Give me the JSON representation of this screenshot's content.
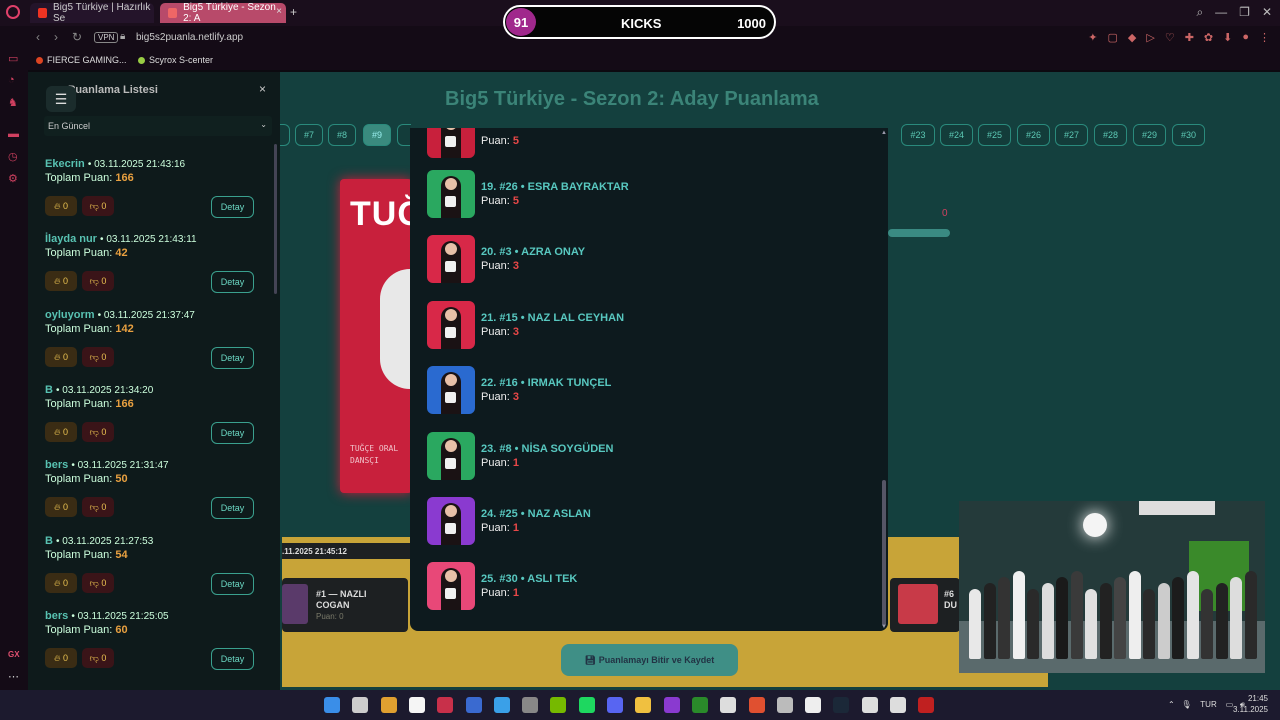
{
  "browser": {
    "tabs": [
      {
        "label": "Big5 Türkiye | Hazırlık Se"
      },
      {
        "label": "Big5 Türkiye - Sezon 2: A"
      }
    ],
    "url": "big5s2puanla.netlify.app",
    "vpn": "VPN",
    "bookmarks": [
      {
        "label": "FIERCE GAMING..."
      },
      {
        "label": "Scyrox S-center"
      }
    ],
    "gx_label": "GX"
  },
  "kicks_overlay": {
    "count": "91",
    "label": "KICKS",
    "value": "1000"
  },
  "left_panel": {
    "title": "Puanlama Listesi",
    "sort_selected": "En Güncel",
    "entries": [
      {
        "name": "Ekecrin",
        "time": "03.11.2025 21:43:16",
        "total_label": "Toplam Puan:",
        "total": "166",
        "likes": "0",
        "dislikes": "0",
        "detail": "Detay"
      },
      {
        "name": "İlayda nur",
        "time": "03.11.2025 21:43:11",
        "total_label": "Toplam Puan:",
        "total": "42",
        "likes": "0",
        "dislikes": "0",
        "detail": "Detay"
      },
      {
        "name": "oyluyorm",
        "time": "03.11.2025 21:37:47",
        "total_label": "Toplam Puan:",
        "total": "142",
        "likes": "0",
        "dislikes": "0",
        "detail": "Detay"
      },
      {
        "name": "B",
        "time": "03.11.2025 21:34:20",
        "total_label": "Toplam Puan:",
        "total": "166",
        "likes": "0",
        "dislikes": "0",
        "detail": "Detay"
      },
      {
        "name": "bers",
        "time": "03.11.2025 21:31:47",
        "total_label": "Toplam Puan:",
        "total": "50",
        "likes": "0",
        "dislikes": "0",
        "detail": "Detay"
      },
      {
        "name": "B",
        "time": "03.11.2025 21:27:53",
        "total_label": "Toplam Puan:",
        "total": "54",
        "likes": "0",
        "dislikes": "0",
        "detail": "Detay"
      },
      {
        "name": "bers",
        "time": "03.11.2025 21:25:05",
        "total_label": "Toplam Puan:",
        "total": "60",
        "likes": "0",
        "dislikes": "0",
        "detail": "Detay"
      }
    ]
  },
  "main": {
    "title": "Big5 Türkiye - Sezon 2: Aday Puanlama",
    "number_buttons": [
      "#7",
      "#8",
      "#9",
      "#23",
      "#24",
      "#25",
      "#26",
      "#27",
      "#28",
      "#29",
      "#30"
    ],
    "active_number": "#9",
    "card_name": "TUĞÇ",
    "card_sub_line1": "TUĞÇE ORAL",
    "card_sub_line2": "DANSÇI",
    "score_zero": "0",
    "timestamp_bar": ".11.2025 21:45:12",
    "bottom_card_left": {
      "name_line1": "#1 — NAZLI",
      "name_line2": "COGAN",
      "points": "Puan: 0"
    },
    "bottom_card_right": {
      "name_line1": "#6",
      "name_line2": "DU"
    },
    "finish_button": "Puanlamayı Bitir ve Kaydet"
  },
  "modal": {
    "rows": [
      {
        "title": "",
        "points_label": "Puan:",
        "points": "5",
        "avatar_color": "#c8203c"
      },
      {
        "title": "19. #26 • ESRA BAYRAKTAR",
        "points_label": "Puan:",
        "points": "5",
        "avatar_color": "#2aa860"
      },
      {
        "title": "20. #3 • AZRA ONAY",
        "points_label": "Puan:",
        "points": "3",
        "avatar_color": "#d82848"
      },
      {
        "title": "21. #15 • NAZ LAL CEYHAN",
        "points_label": "Puan:",
        "points": "3",
        "avatar_color": "#d82848"
      },
      {
        "title": "22. #16 • IRMAK TUNÇEL",
        "points_label": "Puan:",
        "points": "3",
        "avatar_color": "#2a6ad0"
      },
      {
        "title": "23. #8 • NİSA SOYGÜDEN",
        "points_label": "Puan:",
        "points": "1",
        "avatar_color": "#2aa860"
      },
      {
        "title": "24. #25 • NAZ ASLAN",
        "points_label": "Puan:",
        "points": "1",
        "avatar_color": "#8a3ad0"
      },
      {
        "title": "25. #30 • ASLI TEK",
        "points_label": "Puan:",
        "points": "1",
        "avatar_color": "#e84878"
      }
    ]
  },
  "taskbar": {
    "lang": "TUR",
    "time": "21:45",
    "date": "3.11.2025",
    "badge": "12"
  }
}
